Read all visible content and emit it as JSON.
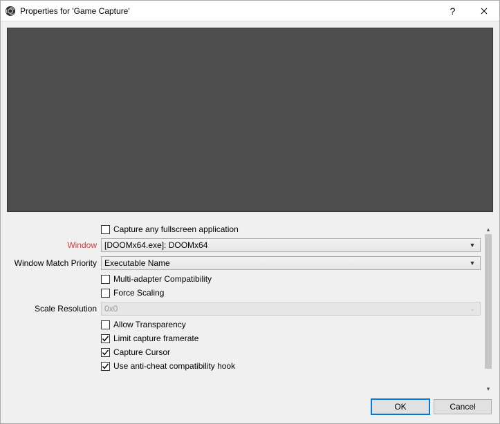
{
  "titlebar": {
    "title": "Properties for 'Game Capture'"
  },
  "form": {
    "capture_fullscreen_label": "Capture any fullscreen application",
    "window_label": "Window",
    "window_value": "[DOOMx64.exe]: DOOMx64",
    "match_priority_label": "Window Match Priority",
    "match_priority_value": "Executable Name",
    "multi_adapter_label": "Multi-adapter Compatibility",
    "force_scaling_label": "Force Scaling",
    "scale_res_label": "Scale Resolution",
    "scale_res_value": "0x0",
    "allow_transparency_label": "Allow Transparency",
    "limit_framerate_label": "Limit capture framerate",
    "capture_cursor_label": "Capture Cursor",
    "anti_cheat_label": "Use anti-cheat compatibility hook"
  },
  "checks": {
    "capture_fullscreen": false,
    "multi_adapter": false,
    "force_scaling": false,
    "allow_transparency": false,
    "limit_framerate": true,
    "capture_cursor": true,
    "anti_cheat": true
  },
  "buttons": {
    "ok": "OK",
    "cancel": "Cancel"
  }
}
